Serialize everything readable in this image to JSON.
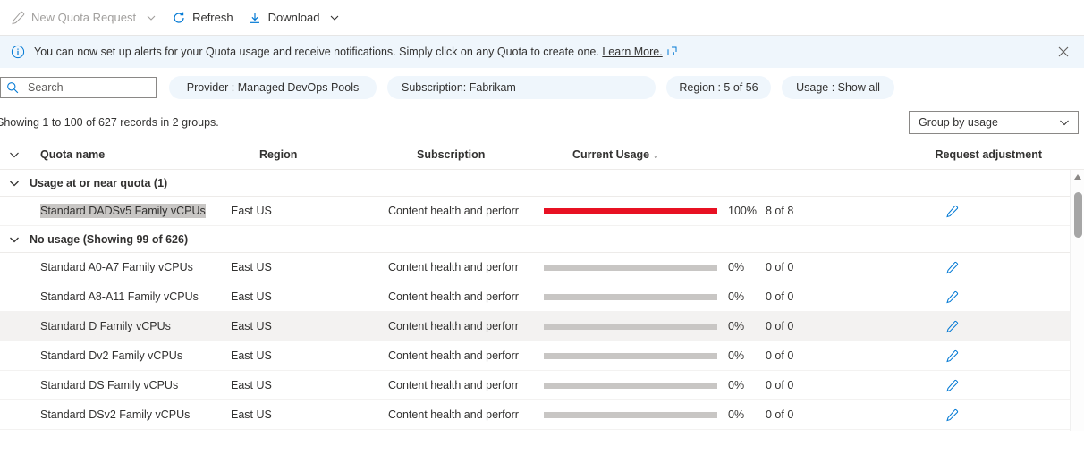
{
  "toolbar": {
    "new_quota_request": {
      "label": "New Quota Request",
      "icon": "pencil-icon",
      "disabled": true
    },
    "refresh": {
      "label": "Refresh",
      "icon": "refresh-icon"
    },
    "download": {
      "label": "Download",
      "icon": "download-icon"
    }
  },
  "banner": {
    "icon": "info-icon",
    "text_before_link": "You can now set up alerts for your Quota usage and receive notifications. Simply click on any Quota to create one.",
    "link_label": "Learn More.",
    "external_icon": "external-link-icon",
    "close_icon": "close-icon",
    "background": "#eff6fc"
  },
  "filters": {
    "search": {
      "placeholder": "Search",
      "value": "",
      "icon": "search-icon"
    },
    "pills": [
      {
        "label": "Provider : Managed DevOps Pools",
        "name": "filter-provider"
      },
      {
        "label": "Subscription: Fabrikam",
        "name": "filter-subscription"
      },
      {
        "label": "Region : 5 of 56",
        "name": "filter-region"
      },
      {
        "label": "Usage : Show all",
        "name": "filter-usage"
      }
    ]
  },
  "records": {
    "summary": "Showing 1 to 100 of 627 records in 2 groups.",
    "group_by": {
      "label": "Group by usage",
      "icon": "chevron-down-icon"
    }
  },
  "table": {
    "headers": {
      "expand": "",
      "quota_name": "Quota name",
      "region": "Region",
      "subscription": "Subscription",
      "current_usage": "Current Usage",
      "sort_indicator": "↓",
      "request_adjustment": "Request adjustment"
    },
    "groups": [
      {
        "title": "Usage at or near quota (1)",
        "name": "group-usage-at-or-near-quota",
        "rows": [
          {
            "quota_name": "Standard DADSv5 Family vCPUs",
            "selected": true,
            "region": "East US",
            "subscription": "Content health and perforr",
            "usage_percent": 100,
            "usage_percent_label": "100%",
            "ratio": "8 of 8",
            "bar_color": "#e81123",
            "hover": false
          }
        ]
      },
      {
        "title": "No usage (Showing 99 of 626)",
        "name": "group-no-usage",
        "rows": [
          {
            "quota_name": "Standard A0-A7 Family vCPUs",
            "selected": false,
            "region": "East US",
            "subscription": "Content health and perforr",
            "usage_percent": 0,
            "usage_percent_label": "0%",
            "ratio": "0 of 0",
            "bar_color": "#c8c6c4",
            "hover": false
          },
          {
            "quota_name": "Standard A8-A11 Family vCPUs",
            "selected": false,
            "region": "East US",
            "subscription": "Content health and perforr",
            "usage_percent": 0,
            "usage_percent_label": "0%",
            "ratio": "0 of 0",
            "bar_color": "#c8c6c4",
            "hover": false
          },
          {
            "quota_name": "Standard D Family vCPUs",
            "selected": false,
            "region": "East US",
            "subscription": "Content health and perforr",
            "usage_percent": 0,
            "usage_percent_label": "0%",
            "ratio": "0 of 0",
            "bar_color": "#c8c6c4",
            "hover": true
          },
          {
            "quota_name": "Standard Dv2 Family vCPUs",
            "selected": false,
            "region": "East US",
            "subscription": "Content health and perforr",
            "usage_percent": 0,
            "usage_percent_label": "0%",
            "ratio": "0 of 0",
            "bar_color": "#c8c6c4",
            "hover": false
          },
          {
            "quota_name": "Standard DS Family vCPUs",
            "selected": false,
            "region": "East US",
            "subscription": "Content health and perforr",
            "usage_percent": 0,
            "usage_percent_label": "0%",
            "ratio": "0 of 0",
            "bar_color": "#c8c6c4",
            "hover": false
          },
          {
            "quota_name": "Standard DSv2 Family vCPUs",
            "selected": false,
            "region": "East US",
            "subscription": "Content health and perforr",
            "usage_percent": 0,
            "usage_percent_label": "0%",
            "ratio": "0 of 0",
            "bar_color": "#c8c6c4",
            "hover": false
          }
        ]
      }
    ],
    "row_action_icon": "pencil-icon"
  },
  "scrollbar": {
    "up_arrow_icon": "caret-up-icon"
  },
  "colors": {
    "accent": "#0078d4",
    "danger": "#e81123",
    "bar_track": "#c8c6c4",
    "banner_bg": "#eff6fc",
    "pill_bg": "#eff6fc"
  }
}
